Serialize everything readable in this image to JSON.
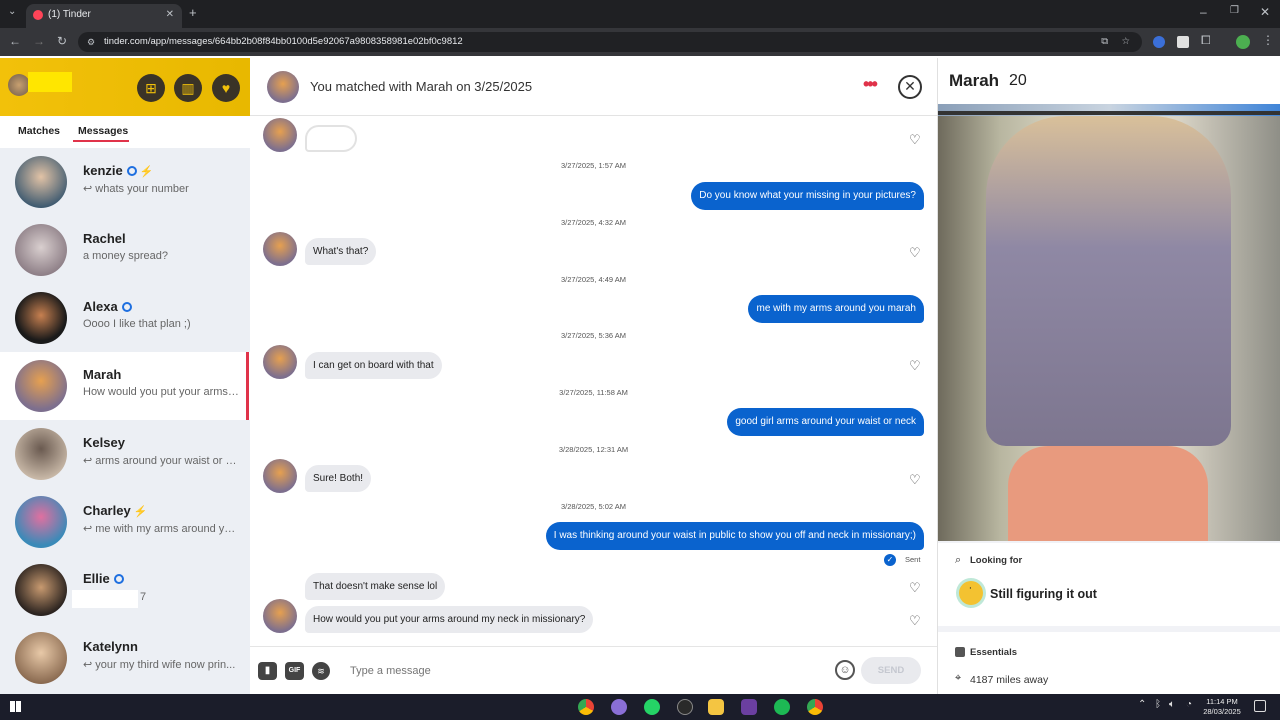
{
  "browser": {
    "tab_title": "(1) Tinder",
    "url": "tinder.com/app/messages/664bb2b08f84bb0100d5e92067a9808358981e02bf0c9812"
  },
  "sidebar": {
    "tabs": [
      "Matches",
      "Messages"
    ],
    "active_tab": "Messages",
    "conversations": [
      {
        "name": "kenzie",
        "preview": "↩ whats your number",
        "verified": true,
        "boost": true
      },
      {
        "name": "Rachel",
        "preview": "a money spread?",
        "verified": false,
        "boost": false
      },
      {
        "name": "Alexa",
        "preview": "Oooo I like that plan ;)",
        "verified": true,
        "boost": false
      },
      {
        "name": "Marah",
        "preview": "How would you put your arms around my neck in missionary?",
        "verified": false,
        "boost": false,
        "active": true
      },
      {
        "name": "Kelsey",
        "preview": "↩ arms around your waist or neck",
        "verified": false,
        "boost": false
      },
      {
        "name": "Charley",
        "preview": "↩ me with my arms around you marah",
        "verified": false,
        "boost": true
      },
      {
        "name": "Ellie",
        "preview": "7",
        "verified": true,
        "boost": false
      },
      {
        "name": "Katelynn",
        "preview": "↩ your my third wife now prin...",
        "verified": false,
        "boost": false
      }
    ]
  },
  "chat": {
    "header": "You matched with Marah on 3/25/2025",
    "messages": [
      {
        "type": "recv",
        "text": ""
      },
      {
        "type": "ts",
        "text": "3/27/2025, 1:57 AM"
      },
      {
        "type": "sent",
        "text": "Do you know what your missing in your pictures?"
      },
      {
        "type": "ts",
        "text": "3/27/2025, 4:32 AM"
      },
      {
        "type": "recv",
        "text": "What's that?"
      },
      {
        "type": "ts",
        "text": "3/27/2025, 4:49 AM"
      },
      {
        "type": "sent",
        "text": "me with my arms around you marah"
      },
      {
        "type": "ts",
        "text": "3/27/2025, 5:36 AM"
      },
      {
        "type": "recv",
        "text": "I can get on board with that"
      },
      {
        "type": "ts",
        "text": "3/27/2025, 11:58 AM"
      },
      {
        "type": "sent",
        "text": "good girl arms around your waist or neck"
      },
      {
        "type": "ts",
        "text": "3/28/2025, 12:31 AM"
      },
      {
        "type": "recv",
        "text": "Sure! Both!"
      },
      {
        "type": "ts",
        "text": "3/28/2025, 5:02 AM"
      },
      {
        "type": "sent",
        "text": "I was thinking around your waist in public to show you off and neck in missionary;)"
      },
      {
        "type": "recv",
        "text": "That doesn't make sense lol"
      },
      {
        "type": "recv",
        "text": "How would you put your arms around my neck in missionary?"
      }
    ],
    "sent_status": "Sent",
    "composer": {
      "gif_label": "GIF",
      "placeholder": "Type a message",
      "send_label": "SEND"
    }
  },
  "profile": {
    "name": "Marah",
    "age": "20",
    "looking_for_label": "Looking for",
    "looking_for_value": "Still figuring it out",
    "essentials_label": "Essentials",
    "distance": "4187 miles away"
  },
  "taskbar": {
    "time": "11:14 PM",
    "date": "28/03/2025"
  },
  "colors": {
    "tinder_yellow": "#f2c10a",
    "sent_bubble": "#0a63ce",
    "recv_bubble": "#e9eaee",
    "active_marker": "#e0334a"
  }
}
